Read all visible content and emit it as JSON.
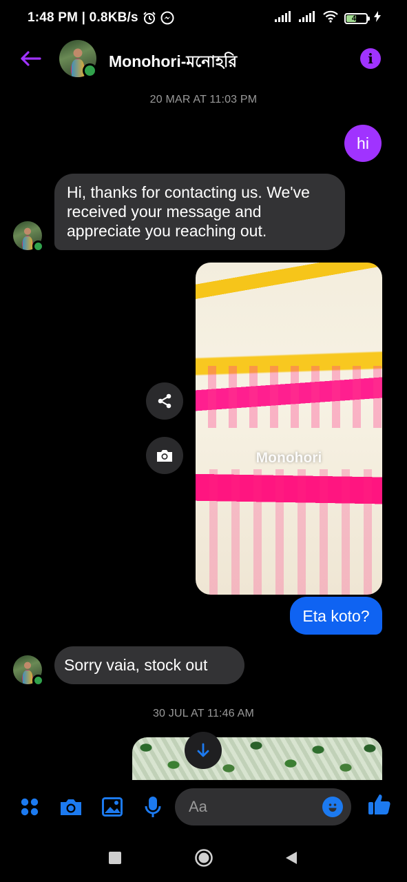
{
  "status_bar": {
    "time_speed": "1:48 PM | 0.8KB/s",
    "battery": "47"
  },
  "header": {
    "title": "Monohori-মনোহরি"
  },
  "messages": {
    "timestamp_1": "20 MAR AT 11:03 PM",
    "out_hi": "hi",
    "in_auto_reply": "Hi, thanks for contacting us. We've received your message and appreciate you reaching out.",
    "photo_watermark": "Monohori",
    "out_question": "Eta koto?",
    "in_reply": "Sorry vaia, stock out",
    "timestamp_2": "30 JUL AT 11:46 AM"
  },
  "composer": {
    "placeholder": "Aa"
  },
  "colors": {
    "accent_purple": "#a033ff",
    "outgoing_blue": "#0f63f2",
    "incoming_gray": "#333335",
    "icon_blue": "#1c7af0",
    "online_green": "#31a24c"
  },
  "icons": {
    "back": "back-arrow-icon",
    "info": "info-icon",
    "share": "share-icon",
    "camera": "camera-icon",
    "scroll_down": "arrow-down-icon",
    "menu": "four-dots-icon",
    "gallery": "image-icon",
    "mic": "microphone-icon",
    "emoji": "smiley-icon",
    "like": "thumbs-up-icon"
  }
}
